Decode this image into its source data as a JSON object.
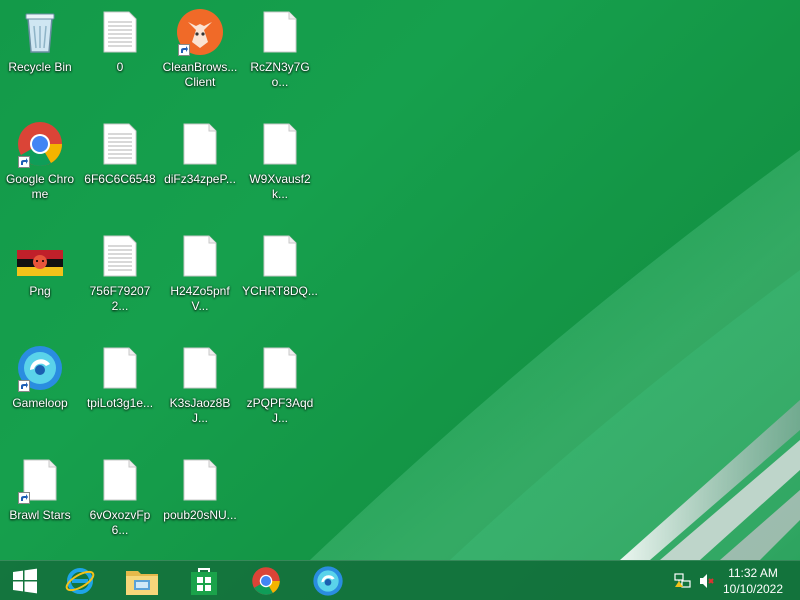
{
  "desktop": {
    "icons": [
      {
        "label": "Recycle Bin",
        "kind": "recycle-bin"
      },
      {
        "label": "0",
        "kind": "text-file"
      },
      {
        "label": "CleanBrowsing Client",
        "display": "CleanBrows... Client",
        "kind": "app"
      },
      {
        "label": "RcZN3y7Go...",
        "kind": "blank-file"
      },
      {
        "label": "Google Chrome",
        "kind": "chrome"
      },
      {
        "label": "6F6C6C6548",
        "kind": "text-file"
      },
      {
        "label": "diFz34zpeP...",
        "kind": "blank-file"
      },
      {
        "label": "W9Xvausf2k...",
        "kind": "blank-file"
      },
      {
        "label": "Png",
        "kind": "image"
      },
      {
        "label": "756F792072...",
        "kind": "text-file"
      },
      {
        "label": "H24Zo5pnfV...",
        "kind": "blank-file"
      },
      {
        "label": "YCHRT8DQ...",
        "kind": "blank-file"
      },
      {
        "label": "Gameloop",
        "kind": "gameloop"
      },
      {
        "label": "tpiLot3g1e...",
        "kind": "blank-file"
      },
      {
        "label": "K3sJaoz8BJ...",
        "kind": "blank-file"
      },
      {
        "label": "zPQPF3AqdJ...",
        "kind": "blank-file"
      },
      {
        "label": "Brawl Stars",
        "kind": "blank-file"
      },
      {
        "label": "6vOxozvFp6...",
        "kind": "blank-file"
      },
      {
        "label": "poub20sNU...",
        "kind": "blank-file"
      }
    ]
  },
  "taskbar": {
    "items": [
      "start-icon",
      "internet-explorer-icon",
      "file-explorer-icon",
      "store-icon",
      "chrome-icon",
      "gameloop-icon"
    ],
    "tray": [
      "network-icon",
      "volume-muted-icon"
    ],
    "clock": {
      "time": "11:32 AM",
      "date": "10/10/2022"
    }
  },
  "colors": {
    "wallpaper": "#139a49",
    "taskbar": "#146e3c"
  }
}
